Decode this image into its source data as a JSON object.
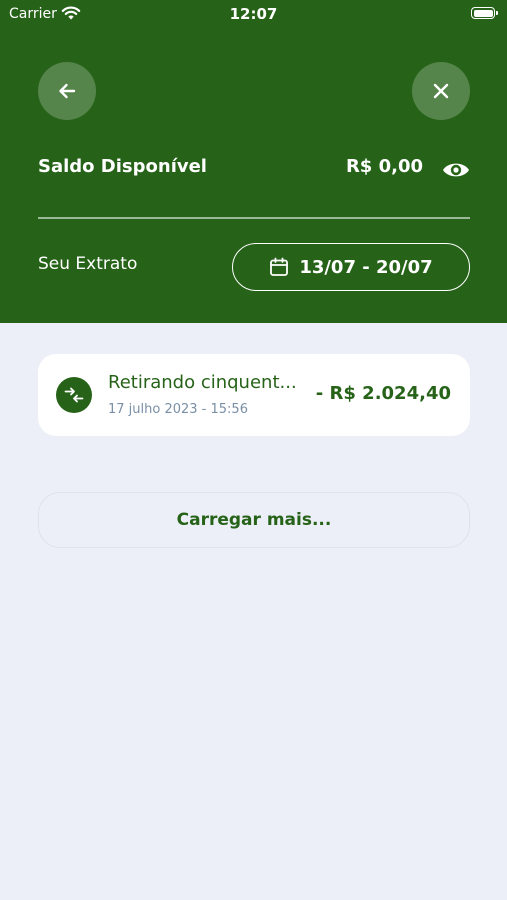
{
  "status_bar": {
    "carrier": "Carrier",
    "time": "12:07"
  },
  "header": {
    "balance_label": "Saldo Disponível",
    "balance_value": "R$ 0,00",
    "statement_label": "Seu Extrato",
    "date_range": "13/07 - 20/07"
  },
  "transactions": [
    {
      "title": "Retirando cinquent...",
      "date": "17 julho 2023 - 15:56",
      "amount": "- R$ 2.024,40"
    }
  ],
  "load_more_label": "Carregar mais...",
  "icons": {
    "back": "arrow-left-icon",
    "close": "close-icon",
    "visibility": "eye-icon",
    "calendar": "calendar-icon",
    "transfer": "transfer-arrows-icon"
  },
  "colors": {
    "primary": "#266319",
    "background": "#eceff7",
    "card": "#ffffff",
    "muted_text": "#7a8fa6"
  }
}
